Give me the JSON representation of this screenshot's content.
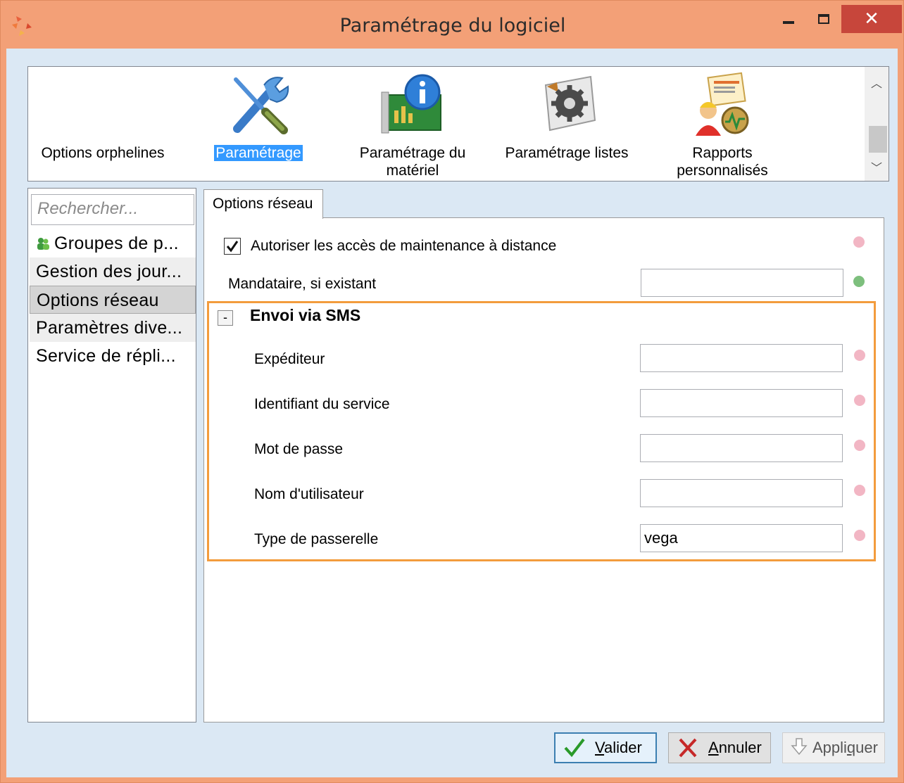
{
  "window": {
    "title": "Paramétrage du logiciel"
  },
  "toolbar": {
    "items": [
      {
        "label": "Options orphelines",
        "icon": "none"
      },
      {
        "label": "Paramétrage",
        "icon": "tools-icon",
        "selected": true
      },
      {
        "label": "Paramétrage du\nmatériel",
        "icon": "hardware-info-icon"
      },
      {
        "label": "Paramétrage listes",
        "icon": "gear-list-icon"
      },
      {
        "label": "Rapports\npersonnalisés",
        "icon": "custom-reports-icon"
      }
    ]
  },
  "nav": {
    "search_placeholder": "Rechercher...",
    "items": [
      {
        "label": "Groupes de p..."
      },
      {
        "label": "Gestion des jour..."
      },
      {
        "label": "Options réseau",
        "selected": true
      },
      {
        "label": "Paramètres dive..."
      },
      {
        "label": "Service de répli..."
      }
    ]
  },
  "tab": {
    "label": "Options réseau"
  },
  "settings": {
    "remote_maintenance_label": "Autoriser les accès de maintenance à distance",
    "remote_maintenance_checked": true,
    "proxy_label": "Mandataire, si existant",
    "proxy_value": "",
    "sms": {
      "collapse_symbol": "-",
      "title": "Envoi via SMS",
      "fields": [
        {
          "label": "Expéditeur",
          "value": ""
        },
        {
          "label": "Identifiant du service",
          "value": ""
        },
        {
          "label": "Mot de passe",
          "value": ""
        },
        {
          "label": "Nom d'utilisateur",
          "value": ""
        },
        {
          "label": "Type de passerelle",
          "value": "vega"
        }
      ]
    }
  },
  "colors": {
    "status_default": "#f2b6c4",
    "status_set": "#7dbf7d",
    "highlight_border": "#f39c3d",
    "title_bar": "#f3a077",
    "close_button": "#c7463b"
  },
  "buttons": {
    "ok_prefix": "",
    "ok_mnemonic": "V",
    "ok_rest": "alider",
    "cancel_mnemonic": "A",
    "cancel_rest": "nnuler",
    "apply_prefix": "Appli",
    "apply_mnemonic": "q",
    "apply_rest": "uer"
  }
}
